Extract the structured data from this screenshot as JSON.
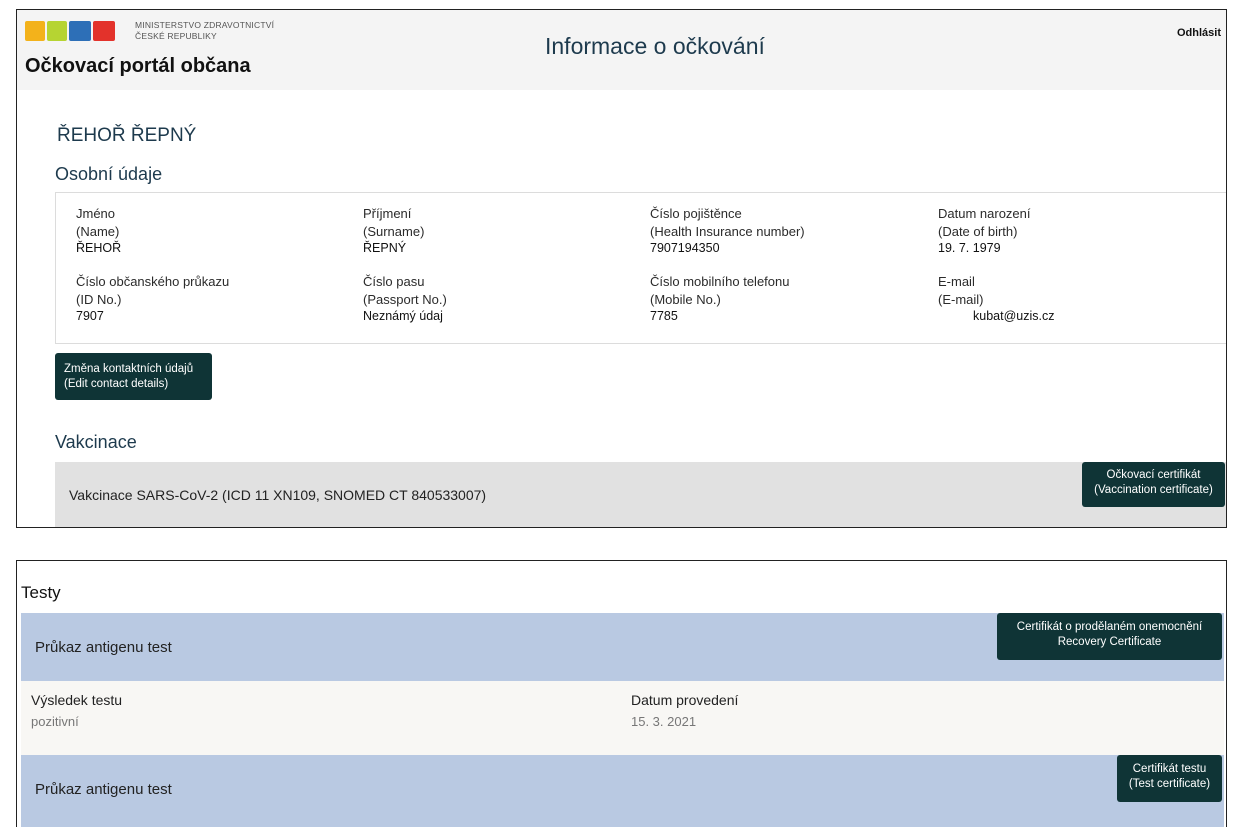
{
  "header": {
    "ministry_line1": "MINISTERSTVO ZDRAVOTNICTVÍ",
    "ministry_line2": "ČESKÉ REPUBLIKY",
    "portal_title": "Očkovací portál občana",
    "page_title": "Informace o očkování",
    "logout_label": "Odhlásit",
    "logo_colors": [
      "#f3b21b",
      "#b6d432",
      "#2d6fb7",
      "#e3322b"
    ]
  },
  "person": {
    "full_name": "ŘEHOŘ ŘEPNÝ"
  },
  "personal_section": {
    "heading": "Osobní údaje",
    "fields": [
      {
        "label": "Jméno",
        "label_en": "(Name)",
        "value": "ŘEHOŘ"
      },
      {
        "label": "Příjmení",
        "label_en": "(Surname)",
        "value": "ŘEPNÝ"
      },
      {
        "label": "Číslo pojištěnce",
        "label_en": "(Health Insurance number)",
        "value": "7907194350"
      },
      {
        "label": "Datum narození",
        "label_en": "(Date of birth)",
        "value": "19. 7. 1979"
      },
      {
        "label": "Číslo občanského průkazu",
        "label_en": "(ID No.)",
        "value": "7907"
      },
      {
        "label": "Číslo pasu",
        "label_en": "(Passport No.)",
        "value": "Neznámý údaj"
      },
      {
        "label": "Číslo mobilního telefonu",
        "label_en": "(Mobile No.)",
        "value": "7785"
      },
      {
        "label": "E-mail",
        "label_en": "(E-mail)",
        "value": "kubat@uzis.cz"
      }
    ],
    "edit_button_line1": "Změna kontaktních údajů",
    "edit_button_line2": "(Edit contact details)"
  },
  "vaccination": {
    "heading": "Vakcinace",
    "item_label": "Vakcinace SARS-CoV-2 (ICD 11 XN109, SNOMED CT 840533007)",
    "cert_button_line1": "Očkovací certifikát",
    "cert_button_line2": "(Vaccination certificate)"
  },
  "tests": {
    "heading": "Testy",
    "items": [
      {
        "label": "Průkaz antigenu test",
        "button_line1": "Certifikát o prodělaném onemocnění",
        "button_line2": "Recovery Certificate",
        "result_label": "Výsledek testu",
        "result_value": "pozitivní",
        "date_label": "Datum provedení",
        "date_value": "15. 3. 2021"
      },
      {
        "label": "Průkaz antigenu test",
        "button_line1": "Certifikát testu",
        "button_line2": "(Test certificate)"
      }
    ]
  },
  "colors": {
    "dark_button": "#0f3436",
    "vaccination_row": "#e1e1e1",
    "test_row": "#b9c9e2",
    "heading_text": "#1d3a4d"
  }
}
